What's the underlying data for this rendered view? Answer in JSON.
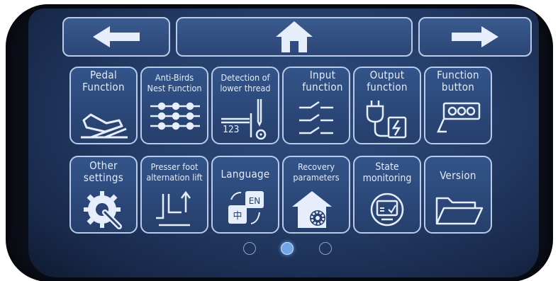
{
  "nav": {
    "back_icon": "arrow-left-icon",
    "home_icon": "home-icon",
    "forward_icon": "arrow-right-icon"
  },
  "tiles": [
    {
      "label": "Pedal\nFunction",
      "icon": "pedal-icon"
    },
    {
      "label": "Anti-Birds\nNest Function",
      "icon": "sliders-icon"
    },
    {
      "label": "Detection of\nlower thread",
      "icon": "needle-thread-icon",
      "counter": "123"
    },
    {
      "label": "Input\nfunction",
      "icon": "input-switch-icon"
    },
    {
      "label": "Output\nfunction",
      "icon": "plug-icon"
    },
    {
      "label": "Function\nbutton",
      "icon": "button-panel-icon"
    },
    {
      "label": "Other\nsettings",
      "icon": "wrench-gear-icon"
    },
    {
      "label": "Presser foot\nalternation lift",
      "icon": "presser-foot-icon"
    },
    {
      "label": "Language",
      "icon": "language-icon",
      "lang_a": "EN",
      "lang_b": "中"
    },
    {
      "label": "Recovery\nparameters",
      "icon": "house-gear-icon"
    },
    {
      "label": "State\nmonitoring",
      "icon": "monitor-icon"
    },
    {
      "label": "Version",
      "icon": "folder-icon"
    }
  ],
  "pagination": {
    "pages": 3,
    "current": 2
  }
}
